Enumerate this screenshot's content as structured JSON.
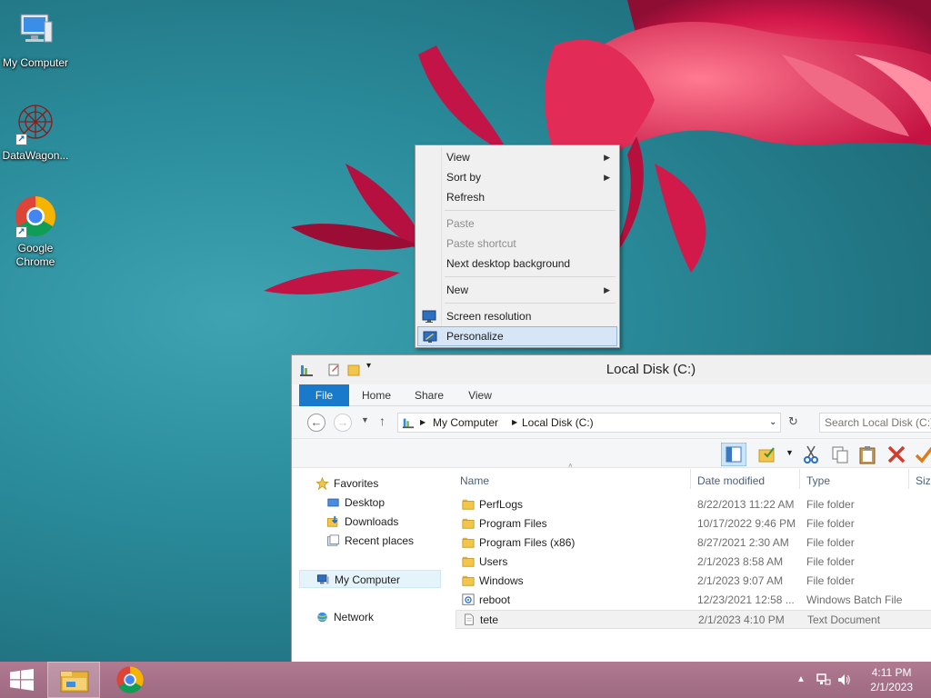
{
  "desktop": {
    "icons": [
      {
        "label": "My Computer"
      },
      {
        "label": "DataWagon..."
      },
      {
        "label": "Google Chrome"
      }
    ]
  },
  "context_menu": {
    "items": [
      {
        "label": "View",
        "submenu": true
      },
      {
        "label": "Sort by",
        "submenu": true
      },
      {
        "label": "Refresh"
      },
      {
        "label": "Paste",
        "disabled": true
      },
      {
        "label": "Paste shortcut",
        "disabled": true
      },
      {
        "label": "Next desktop background"
      },
      {
        "label": "New",
        "submenu": true
      },
      {
        "label": "Screen resolution",
        "icon": "monitor-icon"
      },
      {
        "label": "Personalize",
        "icon": "personalize-icon",
        "highlighted": true
      }
    ]
  },
  "explorer": {
    "title": "Local Disk (C:)",
    "tabs": [
      "File",
      "Home",
      "Share",
      "View"
    ],
    "path": [
      "My Computer",
      "Local Disk (C:)"
    ],
    "search_placeholder": "Search Local Disk (C:)",
    "nav": {
      "favorites": "Favorites",
      "desktop": "Desktop",
      "downloads": "Downloads",
      "recent": "Recent places",
      "computer": "My Computer",
      "network": "Network"
    },
    "columns": {
      "name": "Name",
      "date": "Date modified",
      "type": "Type",
      "size": "Size"
    },
    "files": [
      {
        "name": "PerfLogs",
        "date": "8/22/2013 11:22 AM",
        "type": "File folder",
        "icon": "folder-icon"
      },
      {
        "name": "Program Files",
        "date": "10/17/2022 9:46 PM",
        "type": "File folder",
        "icon": "folder-icon"
      },
      {
        "name": "Program Files (x86)",
        "date": "8/27/2021 2:30 AM",
        "type": "File folder",
        "icon": "folder-icon"
      },
      {
        "name": "Users",
        "date": "2/1/2023 8:58 AM",
        "type": "File folder",
        "icon": "folder-icon"
      },
      {
        "name": "Windows",
        "date": "2/1/2023 9:07 AM",
        "type": "File folder",
        "icon": "folder-icon"
      },
      {
        "name": "reboot",
        "date": "12/23/2021 12:58 ...",
        "type": "Windows Batch File",
        "icon": "batch-file-icon"
      },
      {
        "name": "tete",
        "date": "2/1/2023 4:10 PM",
        "type": "Text Document",
        "icon": "text-file-icon"
      }
    ]
  },
  "taskbar": {
    "time": "4:11 PM",
    "date": "2/1/2023"
  },
  "colors": {
    "accent": "#1979ca",
    "taskbar": "#a36c85",
    "desktop": "#2b8d9c",
    "flower": "#d81e4a"
  }
}
